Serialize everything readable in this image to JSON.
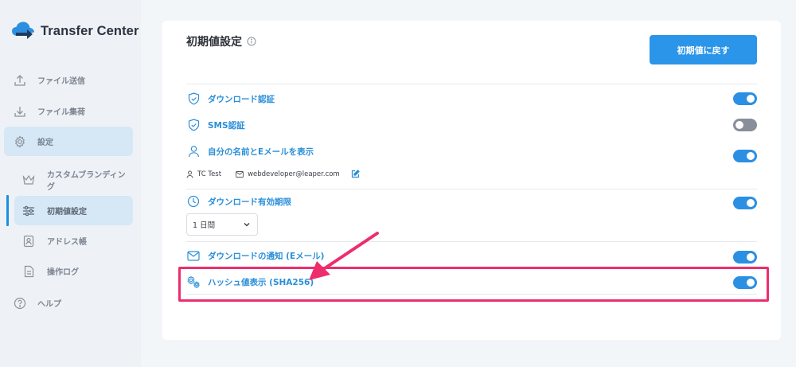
{
  "app": {
    "logo_text": "Transfer Center"
  },
  "sidebar": {
    "items": [
      {
        "label": "ファイル送信"
      },
      {
        "label": "ファイル集荷"
      },
      {
        "label": "設定"
      },
      {
        "label": "カスタムブランディング"
      },
      {
        "label": "初期値設定"
      },
      {
        "label": "アドレス帳"
      },
      {
        "label": "操作ログ"
      },
      {
        "label": "ヘルプ"
      }
    ]
  },
  "main": {
    "title": "初期値設定",
    "reset_button": "初期値に戻す",
    "settings": [
      {
        "label": "ダウンロード認証",
        "enabled": true
      },
      {
        "label": "SMS認証",
        "enabled": false
      },
      {
        "label": "自分の名前とEメールを表示",
        "enabled": true
      },
      {
        "label": "ダウンロード有効期限",
        "enabled": true
      },
      {
        "label": "ダウンロードの通知 (Eメール)",
        "enabled": true
      },
      {
        "label": "ハッシュ値表示 (SHA256)",
        "enabled": true
      }
    ],
    "user": {
      "name": "TC Test",
      "email": "webdeveloper@leaper.com"
    },
    "expiry_select": {
      "value": "1 日間"
    }
  },
  "colors": {
    "accent": "#2b95e9",
    "highlight": "#ee2d6d",
    "toggle_off": "#888f9a"
  }
}
